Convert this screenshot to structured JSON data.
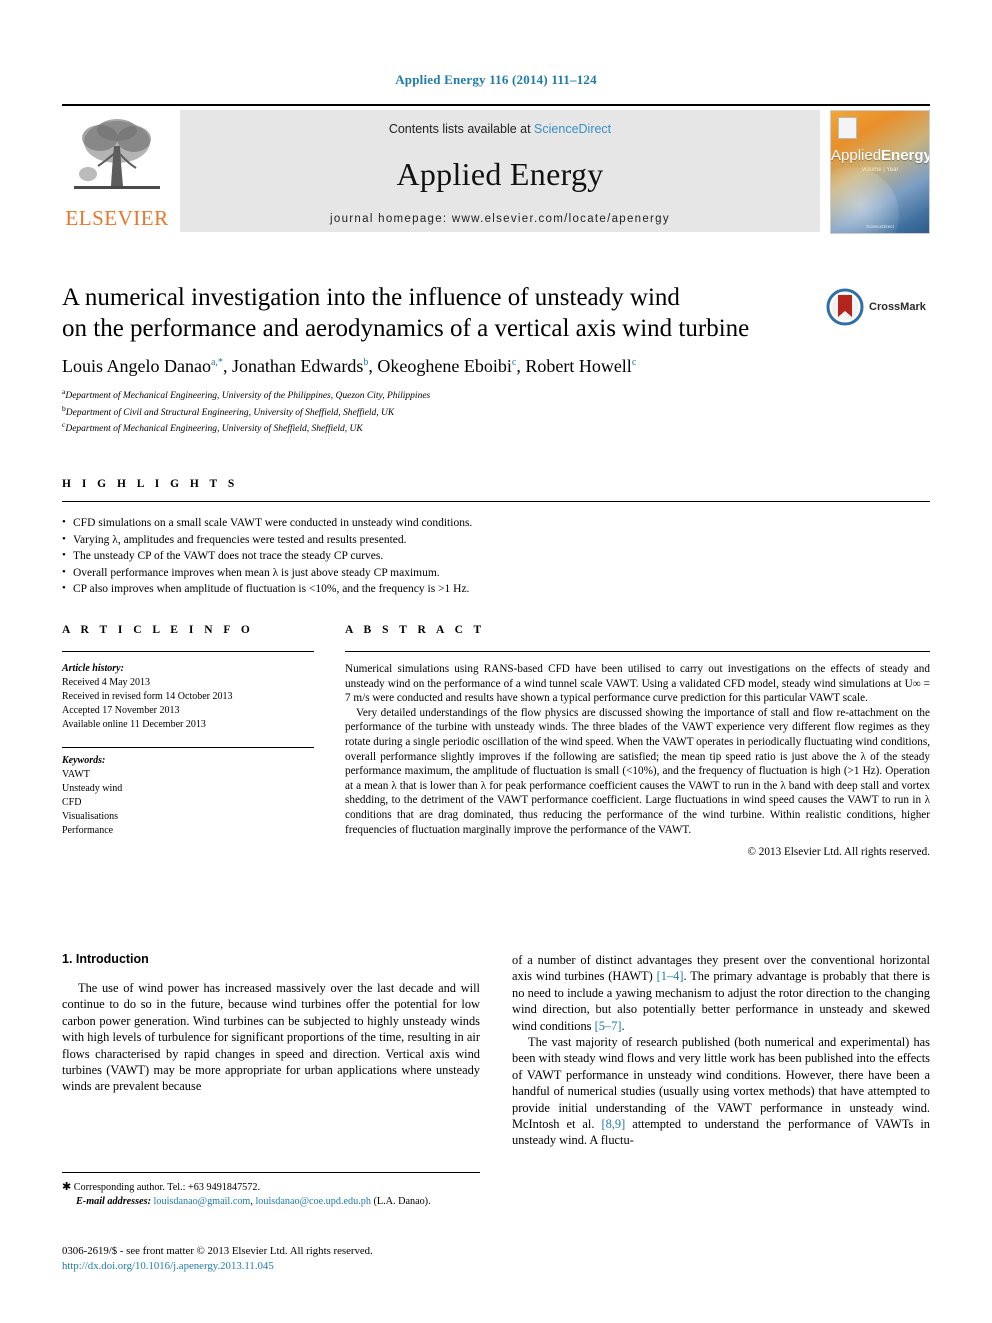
{
  "running_head": "Applied Energy 116 (2014) 111–124",
  "masthead": {
    "publisher": "ELSEVIER",
    "contents_prefix": "Contents lists available at ",
    "sciencedirect": "ScienceDirect",
    "journal_title": "Applied Energy",
    "homepage": "journal homepage: www.elsevier.com/locate/apenergy",
    "cover": {
      "title_a": "Applied",
      "title_b": "Energy",
      "subtitle": "Volume | Year",
      "footer": "ScienceDirect"
    }
  },
  "article": {
    "title": "A numerical investigation into the influence of unsteady wind on the performance and aerodynamics of a vertical axis wind turbine",
    "title_line1": "A numerical investigation into the influence of unsteady wind",
    "title_line2": "on the performance and aerodynamics of a vertical axis wind turbine",
    "crossmark_label": "CrossMark",
    "authors": [
      {
        "name": "Louis Angelo Danao",
        "marks": "a,*"
      },
      {
        "name": "Jonathan Edwards",
        "marks": "b"
      },
      {
        "name": "Okeoghene Eboibi",
        "marks": "c"
      },
      {
        "name": "Robert Howell",
        "marks": "c"
      }
    ],
    "affiliations": [
      {
        "mark": "a",
        "text": "Department of Mechanical Engineering, University of the Philippines, Quezon City, Philippines"
      },
      {
        "mark": "b",
        "text": "Department of Civil and Structural Engineering, University of Sheffield, Sheffield, UK"
      },
      {
        "mark": "c",
        "text": "Department of Mechanical Engineering, University of Sheffield, Sheffield, UK"
      }
    ]
  },
  "highlights": {
    "label": "H I G H L I G H T S",
    "items": [
      "CFD simulations on a small scale VAWT were conducted in unsteady wind conditions.",
      "Varying λ, amplitudes and frequencies were tested and results presented.",
      "The unsteady CP of the VAWT does not trace the steady CP curves.",
      "Overall performance improves when mean λ is just above steady CP maximum.",
      "CP also improves when amplitude of fluctuation is <10%, and the frequency is >1 Hz."
    ]
  },
  "article_info": {
    "label": "A R T I C L E    I N F O",
    "history_label": "Article history:",
    "history": [
      "Received 4 May 2013",
      "Received in revised form 14 October 2013",
      "Accepted 17 November 2013",
      "Available online 11 December 2013"
    ],
    "keywords_label": "Keywords:",
    "keywords": [
      "VAWT",
      "Unsteady wind",
      "CFD",
      "Visualisations",
      "Performance"
    ]
  },
  "abstract": {
    "label": "A B S T R A C T",
    "paragraph1": "Numerical simulations using RANS-based CFD have been utilised to carry out investigations on the effects of steady and unsteady wind on the performance of a wind tunnel scale VAWT. Using a validated CFD model, steady wind simulations at U∞ = 7 m/s were conducted and results have shown a typical performance curve prediction for this particular VAWT scale.",
    "paragraph2": "Very detailed understandings of the flow physics are discussed showing the importance of stall and flow re-attachment on the performance of the turbine with unsteady winds. The three blades of the VAWT experience very different flow regimes as they rotate during a single periodic oscillation of the wind speed. When the VAWT operates in periodically fluctuating wind conditions, overall performance slightly improves if the following are satisfied; the mean tip speed ratio is just above the λ of the steady performance maximum, the amplitude of fluctuation is small (<10%), and the frequency of fluctuation is high (>1 Hz). Operation at a mean λ that is lower than λ for peak performance coefficient causes the VAWT to run in the λ band with deep stall and vortex shedding, to the detriment of the VAWT performance coefficient. Large fluctuations in wind speed causes the VAWT to run in λ conditions that are drag dominated, thus reducing the performance of the wind turbine. Within realistic conditions, higher frequencies of fluctuation marginally improve the performance of the VAWT.",
    "copyright": "© 2013 Elsevier Ltd. All rights reserved."
  },
  "introduction": {
    "heading": "1. Introduction",
    "left_p1": "The use of wind power has increased massively over the last decade and will continue to do so in the future, because wind turbines offer the potential for low carbon power generation. Wind turbines can be subjected to highly unsteady winds with high levels of turbulence for significant proportions of the time, resulting in air flows characterised by rapid changes in speed and direction. Vertical axis wind turbines (VAWT) may be more appropriate for urban applications where unsteady winds are prevalent because",
    "right_p1_a": "of a number of distinct advantages they present over the conventional horizontal axis wind turbines (HAWT) ",
    "right_p1_cite1": "[1–4]",
    "right_p1_b": ". The primary advantage is probably that there is no need to include a yawing mechanism to adjust the rotor direction to the changing wind direction, but also potentially better performance in unsteady and skewed wind conditions ",
    "right_p1_cite2": "[5–7]",
    "right_p1_c": ".",
    "right_p2_a": "The vast majority of research published (both numerical and experimental) has been with steady wind flows and very little work has been published into the effects of VAWT performance in unsteady wind conditions. However, there have been a handful of numerical studies (usually using vortex methods) that have attempted to provide initial understanding of the VAWT performance in unsteady wind. McIntosh et al. ",
    "right_p2_cite": "[8,9]",
    "right_p2_b": " attempted to understand the performance of VAWTs in unsteady wind. A fluctu-"
  },
  "footnotes": {
    "corresponding": "Corresponding author. Tel.: +63 9491847572.",
    "email_label": "E-mail addresses:",
    "email1": "louisdanao@gmail.com",
    "email2": "louisdanao@coe.upd.edu.ph",
    "email_attrib": "(L.A. Danao).",
    "imprint": "0306-2619/$ - see front matter © 2013 Elsevier Ltd. All rights reserved.",
    "doi": "http://dx.doi.org/10.1016/j.apenergy.2013.11.045"
  },
  "colors": {
    "link": "#1f7bab",
    "elsevier_orange": "#E8762C",
    "banner_gray": "#e6e6e6"
  }
}
